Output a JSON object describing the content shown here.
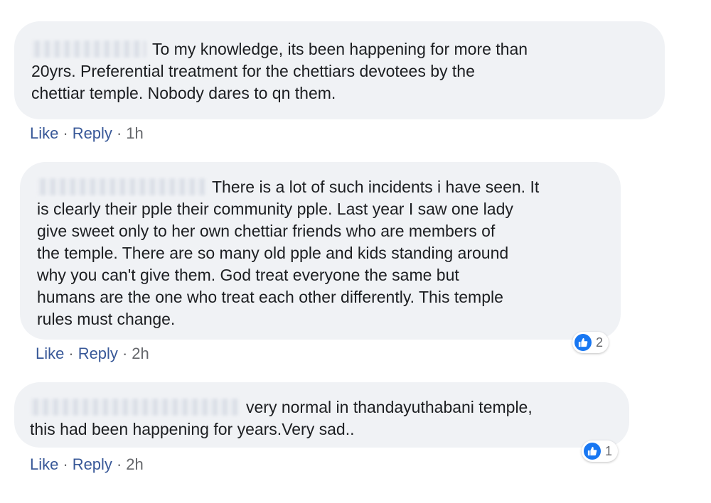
{
  "comments": [
    {
      "text_lines": [
        "To my knowledge, its been happening for more than",
        "20yrs. Preferential treatment for the chettiars devotees by the",
        "chettiar temple. Nobody dares to qn them."
      ],
      "like_label": "Like",
      "reply_label": "Reply",
      "separator": "·",
      "time": "1h"
    },
    {
      "text_lines": [
        "There is a lot of such incidents i have seen. It",
        "is clearly their pple their community pple. Last year I saw one lady",
        "give sweet only to her own chettiar friends who are members of",
        "the temple. There are so many old pple and kids standing around",
        "why you can't give them. God treat everyone the same but",
        "humans are the one who treat each other differently. This temple",
        "rules must change."
      ],
      "like_label": "Like",
      "reply_label": "Reply",
      "separator": "·",
      "time": "2h",
      "reaction_count": "2",
      "reaction_icon": "thumbs-up-icon"
    },
    {
      "text_lines": [
        "very normal in thandayuthabani temple,",
        "this had been happening for years.Very sad.."
      ],
      "like_label": "Like",
      "reply_label": "Reply",
      "separator": "·",
      "time": "2h",
      "reaction_count": "1",
      "reaction_icon": "thumbs-up-icon"
    }
  ],
  "colors": {
    "bubble": "#f0f2f5",
    "link": "#385898",
    "meta": "#65676b",
    "like_blue": "#1877f2"
  }
}
